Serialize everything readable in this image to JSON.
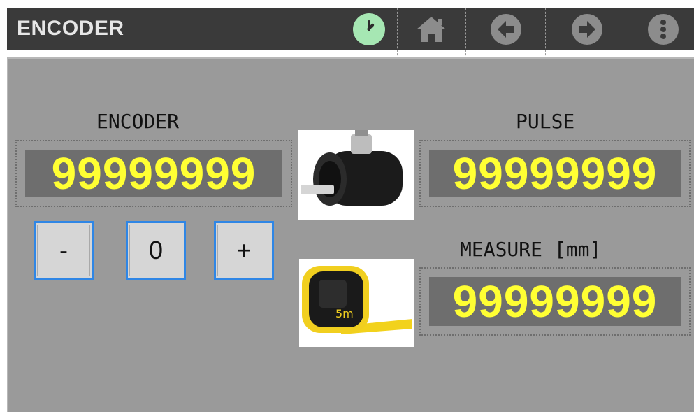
{
  "header": {
    "title": "ENCODER",
    "icons": {
      "clock": "clock-icon",
      "home": "home-icon",
      "back": "arrow-left-icon",
      "forward": "arrow-right-icon",
      "menu": "more-vertical-icon"
    }
  },
  "encoder": {
    "label": "ENCODER",
    "value": "99999999",
    "buttons": {
      "minus": "-",
      "reset": "0",
      "plus": "+"
    }
  },
  "pulse": {
    "label": "PULSE",
    "value": "99999999"
  },
  "measure": {
    "label": "MEASURE [mm]",
    "value": "99999999"
  },
  "colors": {
    "display_text": "#ffff33",
    "display_bg": "#6e6e6e",
    "panel_bg": "#9a9a9a",
    "button_border": "#2f86e5",
    "clock_bg": "#a6e7b3"
  }
}
